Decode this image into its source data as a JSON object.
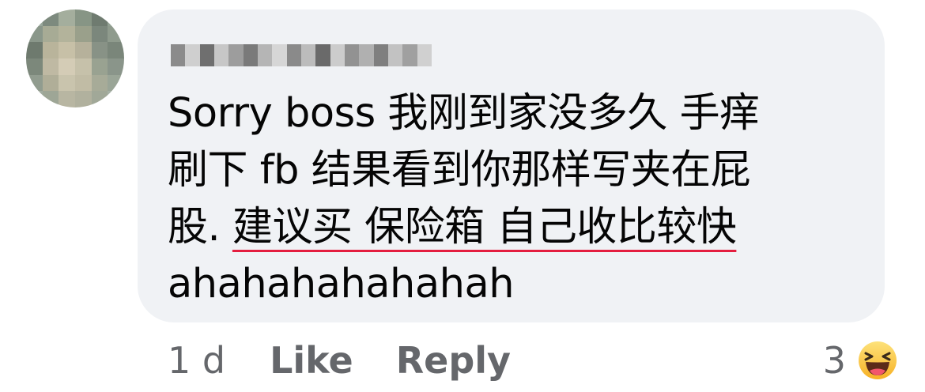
{
  "comment": {
    "avatar_colors": [
      "#9aa89c",
      "#7d8a7e",
      "#a4ae9d",
      "#879585",
      "#6f7b70",
      "#93a193",
      "#8a978a",
      "#a7ab95",
      "#b3b39b",
      "#9aa08b",
      "#7b877c",
      "#8f9b8d",
      "#6e7a6e",
      "#b9b49b",
      "#c7c0a7",
      "#b6b19b",
      "#889286",
      "#7a867a",
      "#7c887b",
      "#bfb9a3",
      "#d4ccb6",
      "#c6c1aa",
      "#99a291",
      "#8a958a",
      "#919c8f",
      "#b0ae98",
      "#c9c4ad",
      "#c1bca5",
      "#a7ab98",
      "#9aa597",
      "#a2ac9f",
      "#9ea696",
      "#b8b6a2",
      "#b1b19e",
      "#a1a898",
      "#a6b0a5"
    ],
    "author_blur_colors": [
      "#8b8b8b",
      "#cfcfcf",
      "#6f6f6f",
      "#c7c7c7",
      "#9d9d9d",
      "#7a7a7a",
      "#b5b5b5",
      "#d6d6d6",
      "#8a8a8a",
      "#bcbcbc",
      "#6a6a6a",
      "#cccccc",
      "#929292",
      "#b0b0b0",
      "#7f7f7f",
      "#c2c2c2",
      "#a0a0a0",
      "#d0d0d0"
    ],
    "text_line1": "Sorry boss 我刚到家没多久 手痒",
    "text_line2": "刷下 fb 结果看到你那样写夹在屁",
    "text_line3_prefix": "股. ",
    "text_line3_underlined": "建议买 保险箱 自己收比较快",
    "text_line4": "ahahahahahahah",
    "underline_color": "#e41e3f"
  },
  "actions": {
    "time": "1 d",
    "like": "Like",
    "reply": "Reply"
  },
  "reactions": {
    "count": "3",
    "icon": "haha-emoji-icon"
  },
  "colors": {
    "bubble": "#f0f2f5",
    "text": "#050505",
    "secondary": "#65676b"
  }
}
